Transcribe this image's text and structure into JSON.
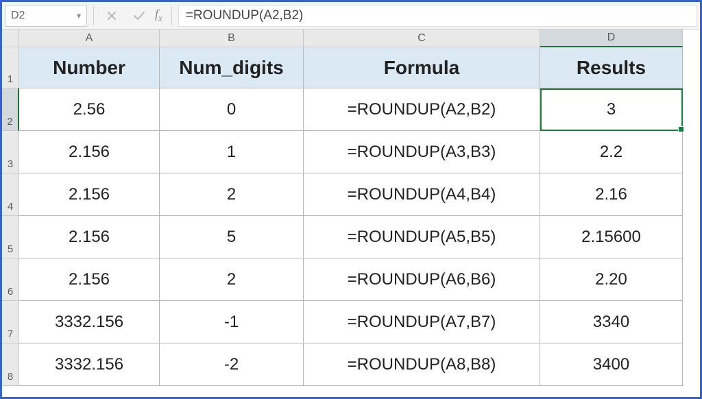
{
  "formula_bar": {
    "name_box": "D2",
    "formula": "=ROUNDUP(A2,B2)"
  },
  "columns": [
    "A",
    "B",
    "C",
    "D"
  ],
  "selected_column": "D",
  "selected_row": "2",
  "headers": {
    "A": "Number",
    "B": "Num_digits",
    "C": "Formula",
    "D": "Results"
  },
  "rows": [
    {
      "r": "1"
    },
    {
      "r": "2",
      "A": "2.56",
      "B": "0",
      "C": "=ROUNDUP(A2,B2)",
      "D": "3"
    },
    {
      "r": "3",
      "A": "2.156",
      "B": "1",
      "C": "=ROUNDUP(A3,B3)",
      "D": "2.2"
    },
    {
      "r": "4",
      "A": "2.156",
      "B": "2",
      "C": "=ROUNDUP(A4,B4)",
      "D": "2.16"
    },
    {
      "r": "5",
      "A": "2.156",
      "B": "5",
      "C": "=ROUNDUP(A5,B5)",
      "D": "2.15600"
    },
    {
      "r": "6",
      "A": "2.156",
      "B": "2",
      "C": "=ROUNDUP(A6,B6)",
      "D": "2.20"
    },
    {
      "r": "7",
      "A": "3332.156",
      "B": "-1",
      "C": "=ROUNDUP(A7,B7)",
      "D": "3340"
    },
    {
      "r": "8",
      "A": "3332.156",
      "B": "-2",
      "C": "=ROUNDUP(A8,B8)",
      "D": "3400"
    }
  ],
  "active_cell": {
    "col": "D",
    "row": "2"
  }
}
